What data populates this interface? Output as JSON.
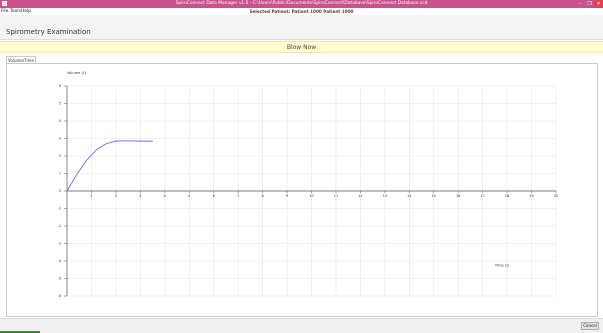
{
  "window": {
    "title": "SpiroConnect Data Manager v1.0 - C:\\Users\\Public\\Documents\\SpiroConnect\\Database\\SpiroConnect Database.scd",
    "minimize_glyph": "–",
    "maximize_glyph": "❐",
    "close_glyph": "✕"
  },
  "menu": {
    "file": "File",
    "tools": "Tools",
    "help": "Help",
    "selected_patient": "Selected Patient: Patient 1000 Patient 1000"
  },
  "section": {
    "title": "Spirometry Examination"
  },
  "status": {
    "prompt": "Blow Now"
  },
  "tabs": [
    {
      "label": "Volume/Time"
    }
  ],
  "footer": {
    "cancel_label": "Cancel"
  },
  "colors": {
    "titlebar": "#c9528a",
    "prompt_bg": "#ffffd0",
    "curve": "#6a6aff"
  },
  "chart_data": {
    "type": "line",
    "title": "",
    "xlabel": "Time (s)",
    "ylabel": "Volume (L)",
    "xlim": [
      0,
      20
    ],
    "ylim": [
      -6,
      6
    ],
    "x_ticks": [
      "1",
      "2",
      "3",
      "4",
      "5",
      "6",
      "7",
      "8",
      "9",
      "10",
      "11",
      "12",
      "13",
      "14",
      "15",
      "16",
      "17",
      "18",
      "19",
      "20"
    ],
    "y_ticks": [
      "6",
      "5",
      "4",
      "3",
      "2",
      "1",
      "0",
      "-1",
      "-2",
      "-3",
      "-4",
      "-5",
      "-6"
    ],
    "grid": true,
    "series": [
      {
        "x": [
          0,
          0.4,
          0.8,
          1.2,
          1.6,
          2.0,
          2.4,
          3.0,
          3.5
        ],
        "y": [
          0,
          0.95,
          1.75,
          2.35,
          2.7,
          2.85,
          2.87,
          2.85,
          2.85
        ]
      }
    ]
  }
}
